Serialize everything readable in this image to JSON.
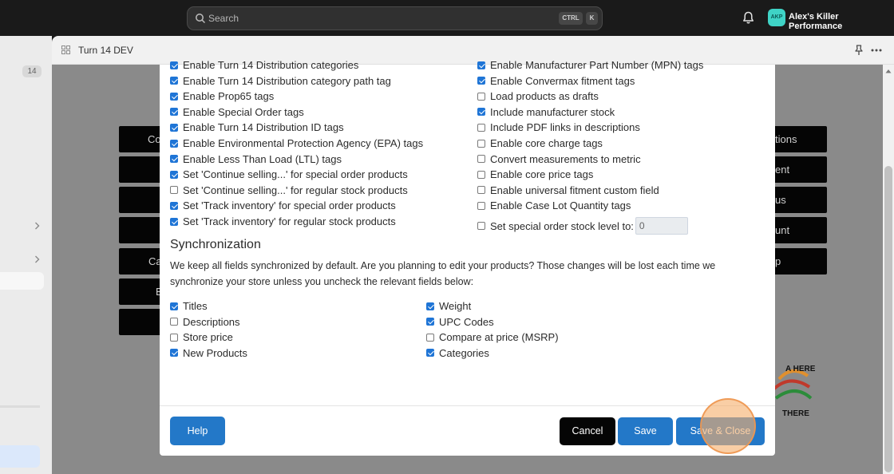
{
  "topbar": {
    "search_placeholder": "Search",
    "shortcut_ctrl": "CTRL",
    "shortcut_key": "K",
    "avatar_initials": "AKP",
    "store_name": "Alex's Killer Performance"
  },
  "app": {
    "title": "Turn 14 DEV"
  },
  "sidebar": {
    "badge_count": "14"
  },
  "background_buttons": {
    "left": [
      "Co",
      "",
      "",
      "",
      "Ca",
      "E",
      ""
    ],
    "right": [
      "tions",
      "ent",
      "us",
      "unt",
      "p"
    ]
  },
  "modal": {
    "options_left": [
      {
        "label": "Enable Turn 14 Distribution categories",
        "checked": true
      },
      {
        "label": "Enable Turn 14 Distribution category path tag",
        "checked": true
      },
      {
        "label": "Enable Prop65 tags",
        "checked": true
      },
      {
        "label": "Enable Special Order tags",
        "checked": true
      },
      {
        "label": "Enable Turn 14 Distribution ID tags",
        "checked": true
      },
      {
        "label": "Enable Environmental Protection Agency (EPA) tags",
        "checked": true
      },
      {
        "label": "Enable Less Than Load (LTL) tags",
        "checked": true
      },
      {
        "label": "Set 'Continue selling...' for special order products",
        "checked": true
      },
      {
        "label": "Set 'Continue selling...' for regular stock products",
        "checked": false
      },
      {
        "label": "Set 'Track inventory' for special order products",
        "checked": true
      },
      {
        "label": "Set 'Track inventory' for regular stock products",
        "checked": true
      }
    ],
    "options_right": [
      {
        "label": "Enable Manufacturer Part Number (MPN) tags",
        "checked": true
      },
      {
        "label": "Enable Convermax fitment tags",
        "checked": true
      },
      {
        "label": "Load products as drafts",
        "checked": false
      },
      {
        "label": "Include manufacturer stock",
        "checked": true
      },
      {
        "label": "Include PDF links in descriptions",
        "checked": false
      },
      {
        "label": "Enable core charge tags",
        "checked": false
      },
      {
        "label": "Convert measurements to metric",
        "checked": false
      },
      {
        "label": "Enable core price tags",
        "checked": false
      },
      {
        "label": "Enable universal fitment custom field",
        "checked": false
      },
      {
        "label": "Enable Case Lot Quantity tags",
        "checked": false
      },
      {
        "label": "Set special order stock level to:",
        "checked": false
      }
    ],
    "special_order_stock_value": "0",
    "sync_title": "Synchronization",
    "sync_description": "We keep all fields synchronized by default. Are you planning to edit your products? Those changes will be lost each time we synchronize your store unless you uncheck the relevant fields below:",
    "sync_left": [
      {
        "label": "Titles",
        "checked": true
      },
      {
        "label": "Descriptions",
        "checked": false
      },
      {
        "label": "Store price",
        "checked": false
      },
      {
        "label": "New Products",
        "checked": true
      }
    ],
    "sync_right": [
      {
        "label": "Weight",
        "checked": true
      },
      {
        "label": "UPC Codes",
        "checked": true
      },
      {
        "label": "Compare at price (MSRP)",
        "checked": false
      },
      {
        "label": "Categories",
        "checked": true
      }
    ],
    "buttons": {
      "help": "Help",
      "cancel": "Cancel",
      "save": "Save",
      "save_close": "Save & Close"
    }
  },
  "colors": {
    "primary_button": "#2378c8",
    "checkbox_checked": "#1f75d6",
    "topbar": "#1a1a1a",
    "click_highlight": "#f6b06e"
  }
}
